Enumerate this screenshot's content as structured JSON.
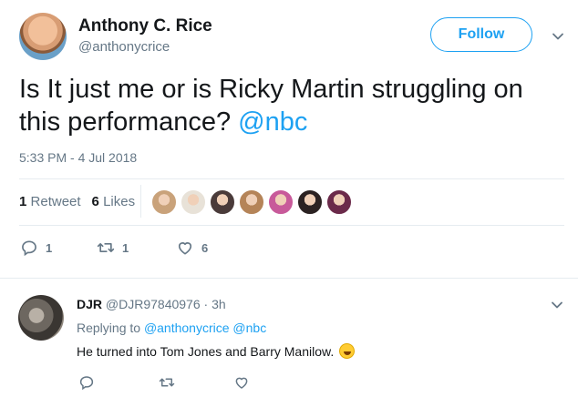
{
  "tweet": {
    "author_name": "Anthony C. Rice",
    "author_handle": "@anthonycrice",
    "follow_label": "Follow",
    "text_main": "Is It just me or is Ricky Martin struggling on this performance? ",
    "text_mention": "@nbc",
    "timestamp": "5:33 PM - 4 Jul 2018",
    "retweets_count": "1",
    "retweets_label": "Retweet",
    "likes_count": "6",
    "likes_label": "Likes",
    "likers": [
      {
        "color": "#c9a27a"
      },
      {
        "color": "#e8e2d8"
      },
      {
        "color": "#4a3b3a"
      },
      {
        "color": "#b58458"
      },
      {
        "color": "#c85a9a"
      },
      {
        "color": "#2b2222"
      },
      {
        "color": "#6b2a4a"
      }
    ],
    "reply_count": "1",
    "retweet_action_count": "1",
    "like_action_count": "6"
  },
  "reply": {
    "author_name": "DJR",
    "author_handle": "@DJR97840976",
    "time": "· 3h",
    "replying_prefix": "Replying to ",
    "replying_to_1": "@anthonycrice",
    "replying_to_2": "@nbc",
    "text": "He turned into Tom Jones and Barry Manilow."
  },
  "colors": {
    "accent": "#1da1f2",
    "muted": "#657786",
    "text": "#14171a"
  }
}
